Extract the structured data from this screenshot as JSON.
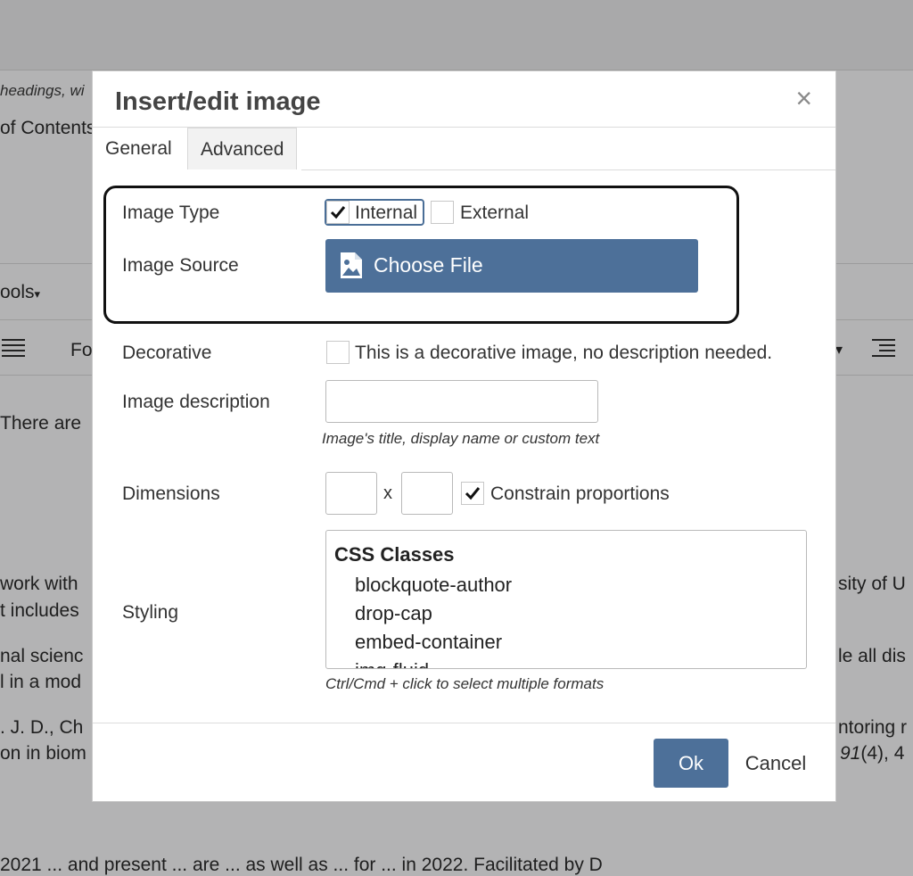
{
  "background": {
    "snippet_headings": "headings, wi",
    "snippet_contents": "of Contents",
    "snippet_tools": "ools",
    "snippet_fo": "Fo",
    "snippet_there": "There are",
    "snippet_work": "work with",
    "snippet_includes": "t includes",
    "snippet_nal": "nal scienc",
    "snippet_mod": "l in a mod",
    "snippet_jd": ". J. D., Ch",
    "snippet_biom": "on in biom",
    "snippet_sity": "sity of U",
    "snippet_le": "le all dis",
    "snippet_ntoring": "ntoring r",
    "snippet_vol": "91",
    "snippet_issue": "(4), 4",
    "snippet_bottom": "2021 ... and present ... are ... as well as ... for ... in 2022. Facilitated by D"
  },
  "dialog": {
    "title": "Insert/edit image",
    "close_glyph": "×",
    "tabs": [
      {
        "label": "General",
        "active": true
      },
      {
        "label": "Advanced",
        "active": false
      }
    ],
    "image_type": {
      "label": "Image Type",
      "options": [
        {
          "label": "Internal",
          "checked": true
        },
        {
          "label": "External",
          "checked": false
        }
      ]
    },
    "image_source": {
      "label": "Image Source",
      "button_label": "Choose File",
      "button_icon": "image-file-icon"
    },
    "decorative": {
      "label": "Decorative",
      "checkbox_text": "This is a decorative image, no description needed.",
      "checked": false
    },
    "image_description": {
      "label": "Image description",
      "value": "",
      "hint": "Image's title, display name or custom text"
    },
    "dimensions": {
      "label": "Dimensions",
      "width": "",
      "height": "",
      "separator": "x",
      "constrain_label": "Constrain proportions",
      "constrain_checked": true
    },
    "styling": {
      "label": "Styling",
      "group_header": "CSS Classes",
      "options": [
        "blockquote-author",
        "drop-cap",
        "embed-container",
        "img-fluid"
      ],
      "hint": "Ctrl/Cmd + click to select multiple formats"
    },
    "buttons": {
      "ok": "Ok",
      "cancel": "Cancel"
    },
    "colors": {
      "primary": "#4d7099",
      "overlay": "#b3b3b4"
    }
  }
}
